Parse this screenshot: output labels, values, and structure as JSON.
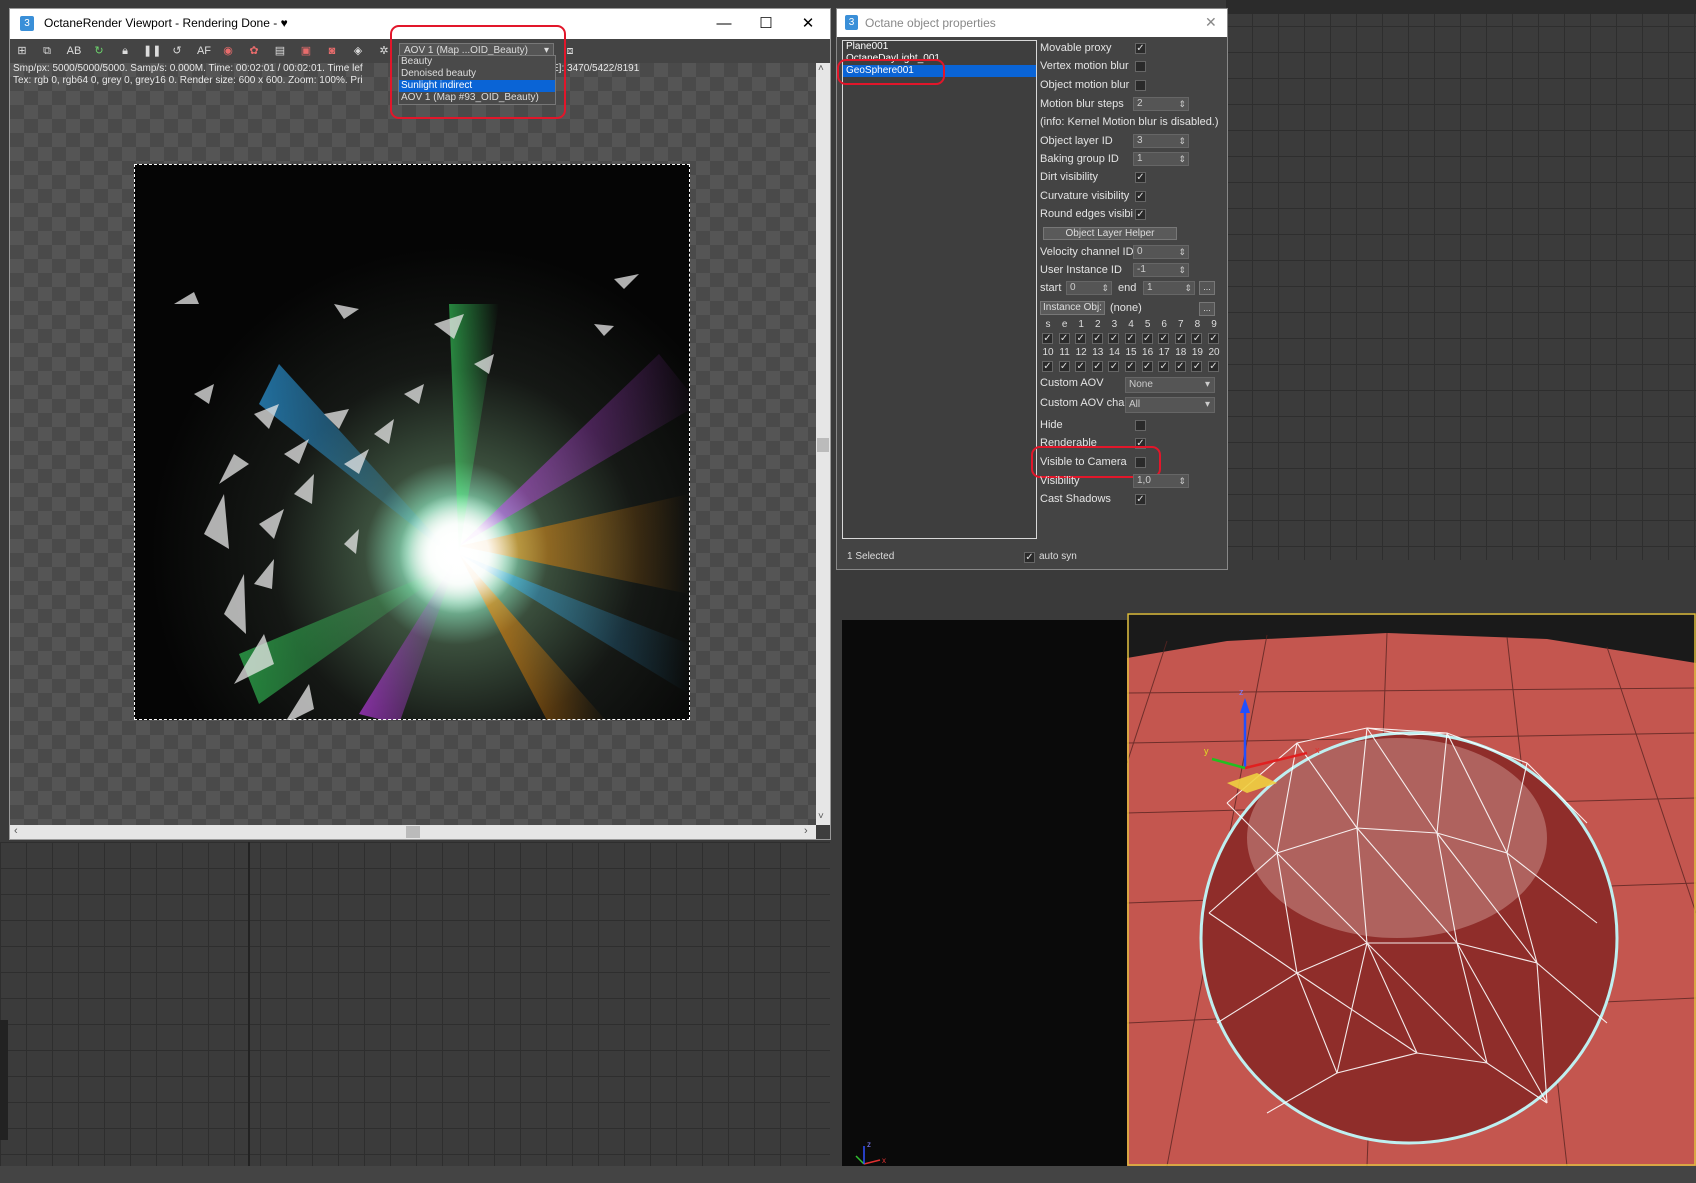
{
  "render_window": {
    "title": "OctaneRender Viewport - Rendering Done - ♥",
    "aov_selected": "AOV 1 (Map ...OID_Beauty)",
    "aov_options": [
      "Beauty",
      "Denoised beauty",
      "Sunlight indirect",
      "AOV 1 (Map #93_OID_Beauty)"
    ],
    "aov_highlight": "Sunlight indirect",
    "status_line1_left": "Smp/px: 5000/5000/5000.   Samp/s: 0.000M.   Time: 00:02:01 / 00:02:01.   Time lef",
    "status_line1_right": "E]: 3470/5422/8191",
    "status_line2_left": "Tex: rgb 0, rgb64 0, grey 0, grey16 0.   Render size: 600 x 600.   Zoom: 100%.   Pri",
    "toolbar_icons": [
      "region-icon",
      "copy-icon",
      "ab-compare-icon",
      "refresh-icon",
      "lock-icon",
      "pause-icon",
      "restart-icon",
      "af-icon",
      "color-icon",
      "clear-icon",
      "film-icon",
      "save-icon",
      "camera-icon",
      "material-icon",
      "settings-icon"
    ]
  },
  "props_window": {
    "title": "Octane object properties",
    "objects": [
      "Plane001",
      "OctaneDayLight_001",
      "GeoSphere001"
    ],
    "selected_object": "GeoSphere001",
    "selected_count": "1 Selected",
    "auto_sync": "auto syn",
    "rows": {
      "movable_proxy": "Movable proxy",
      "vertex_motion_blur": "Vertex motion blur",
      "object_motion_blur": "Object motion blur",
      "motion_blur_steps": "Motion blur steps",
      "motion_blur_steps_value": "2",
      "info_text": "(info: Kernel Motion blur is disabled.)",
      "object_layer_id": "Object layer ID",
      "object_layer_id_value": "3",
      "baking_group_id": "Baking group ID",
      "baking_group_id_value": "1",
      "dirt_visibility": "Dirt visibility",
      "curvature_visibility": "Curvature visibility",
      "round_edges_visibility": "Round edges visibility",
      "object_layer_helper": "Object Layer Helper",
      "velocity_channel_id": "Velocity channel ID",
      "velocity_channel_id_value": "0",
      "user_instance_id": "User Instance ID",
      "user_instance_id_value": "-1",
      "start_label": "start",
      "start_value": "0",
      "end_label": "end",
      "end_value": "1",
      "ellipsis": "...",
      "instance_obj": "Instance Obj:",
      "instance_obj_value": "(none)",
      "custom_aov": "Custom AOV",
      "custom_aov_value": "None",
      "custom_aov_chan": "Custom AOV chan.",
      "custom_aov_chan_value": "All",
      "hide": "Hide",
      "renderable": "Renderable",
      "visible_to_camera": "Visible to Camera",
      "visibility": "Visibility",
      "visibility_value": "1,0",
      "cast_shadows": "Cast Shadows"
    },
    "grid_header_1": [
      "s",
      "e",
      "1",
      "2",
      "3",
      "4",
      "5",
      "6",
      "7",
      "8",
      "9"
    ],
    "grid_header_2": [
      "10",
      "11",
      "12",
      "13",
      "14",
      "15",
      "16",
      "17",
      "18",
      "19",
      "20"
    ]
  },
  "viewport": {
    "gizmo_axes": [
      "x",
      "y",
      "z"
    ]
  },
  "colors": {
    "highlight_red": "#e2162a",
    "selection_blue": "#0a64d6",
    "floor_red": "#c4564f"
  }
}
